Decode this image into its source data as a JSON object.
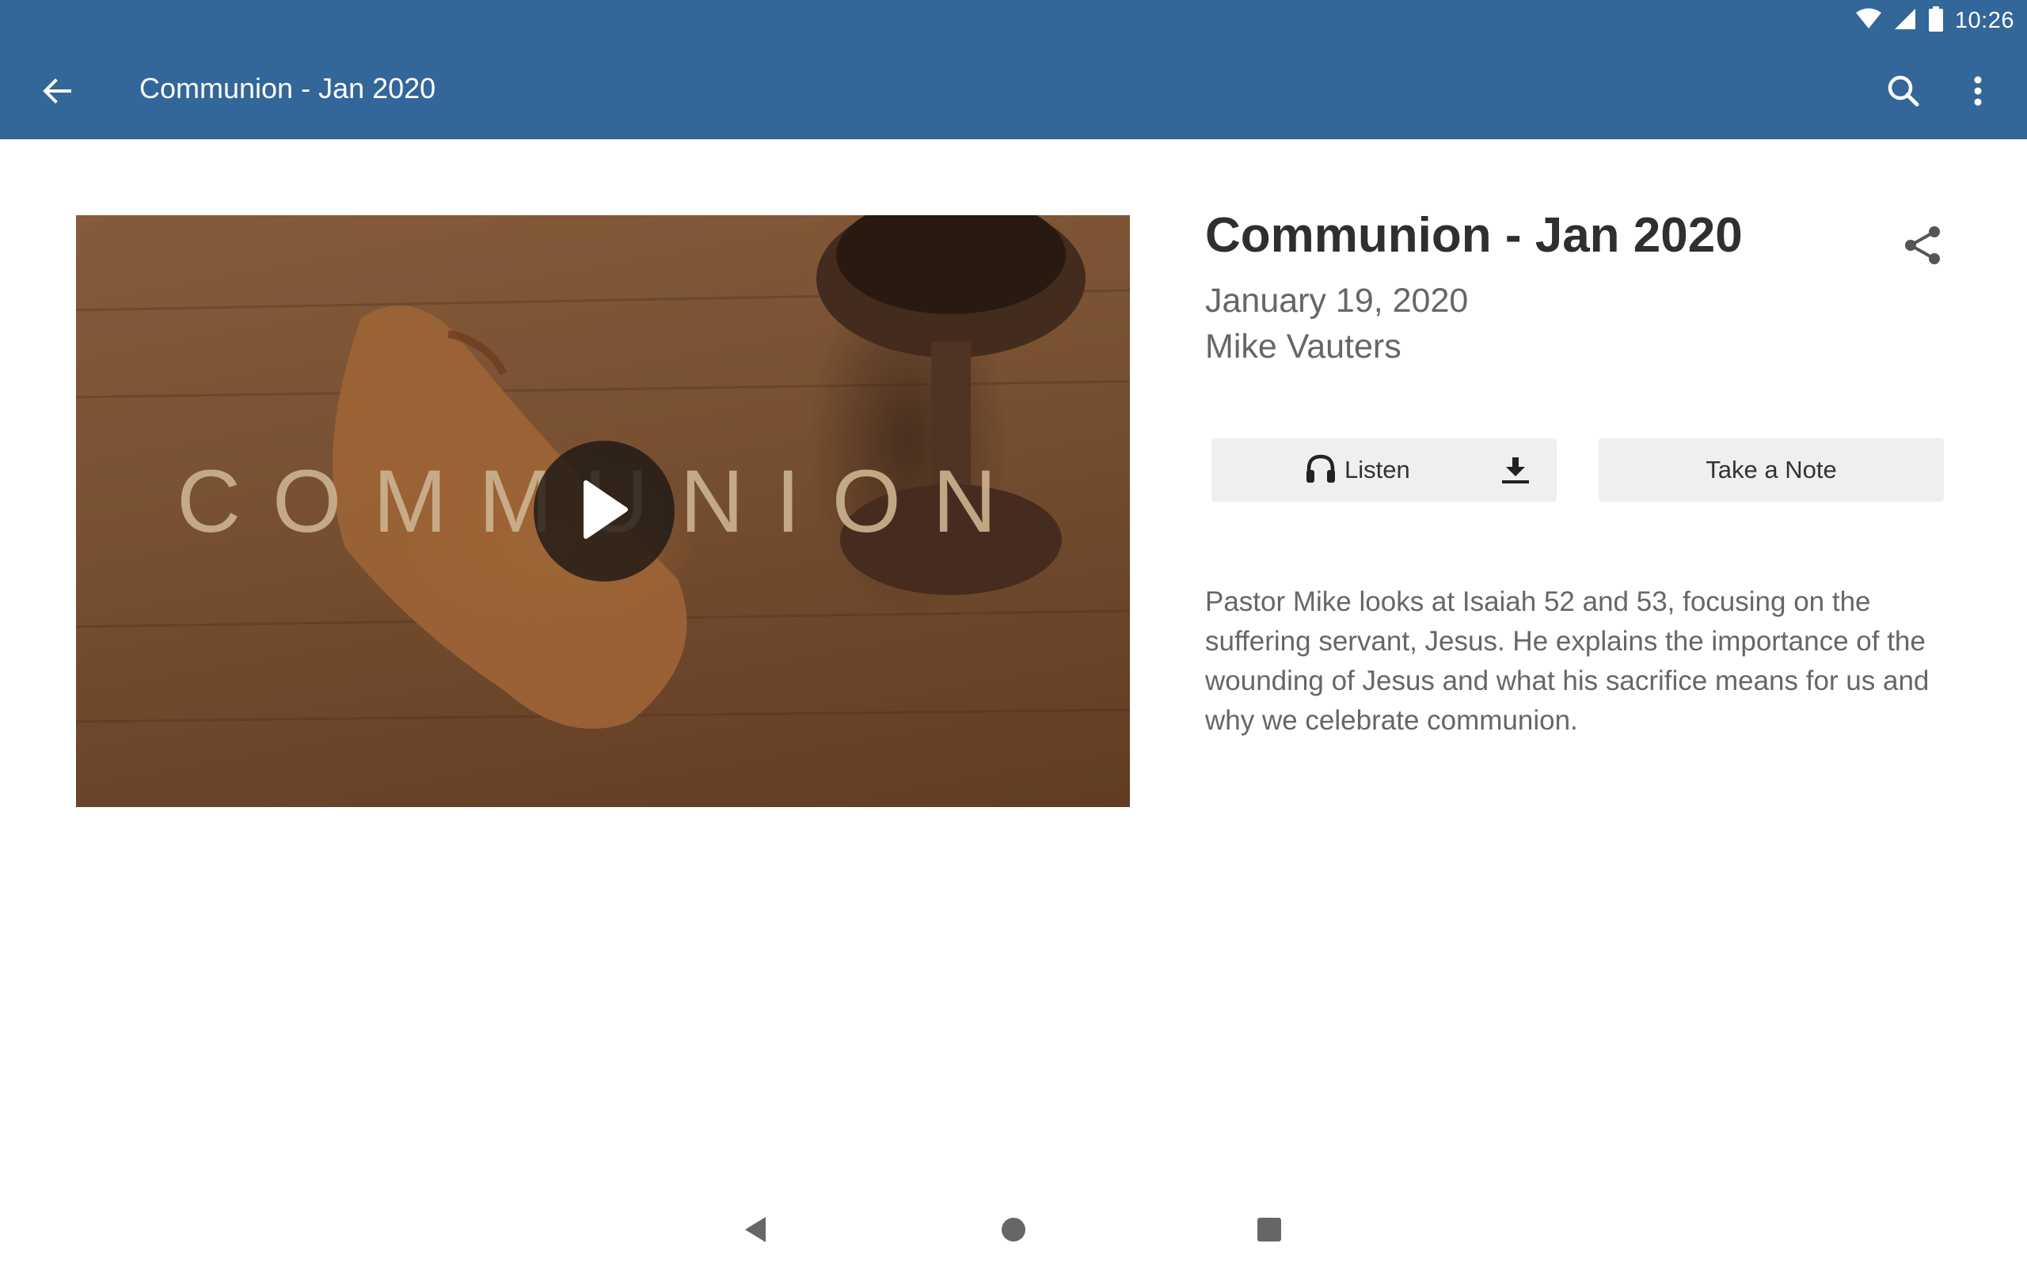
{
  "status_bar": {
    "time": "10:26",
    "icons": [
      "wifi-icon",
      "cell-signal-icon",
      "battery-icon"
    ]
  },
  "app_bar": {
    "title": "Communion - Jan 2020",
    "back_icon": "arrow-back-icon",
    "search_icon": "search-icon",
    "more_icon": "more-vert-icon",
    "background_color": "#336699"
  },
  "video": {
    "overlay_text": "COMMUNION",
    "play_icon": "play-icon"
  },
  "sermon": {
    "title": "Communion - Jan 2020",
    "date": "January 19, 2020",
    "speaker": "Mike Vauters",
    "share_icon": "share-icon",
    "description": "Pastor Mike looks at Isaiah 52 and 53, focusing on the suffering servant, Jesus.  He explains the importance of the wounding of Jesus and what his sacrifice means for us and why we celebrate communion."
  },
  "actions": {
    "listen_label": "Listen",
    "listen_icon": "headphones-icon",
    "download_icon": "download-icon",
    "note_label": "Take a Note"
  },
  "nav_bar": {
    "icons": [
      "nav-back-icon",
      "nav-home-icon",
      "nav-recents-icon"
    ]
  }
}
